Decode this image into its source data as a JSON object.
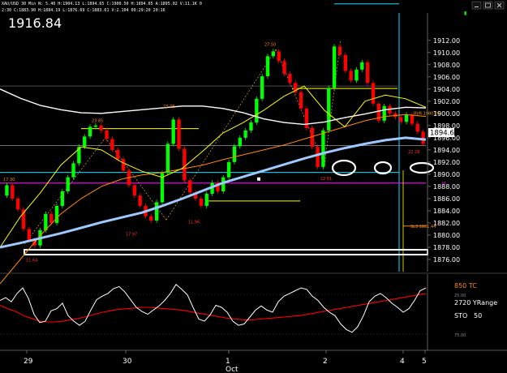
{
  "header": {
    "symbol_line": "XAU/USD 30 Min  N: 5.40  H:1904.13  L:1894.65  C:1900.50  H:1894.65  A:1895.02  V:11.1K  0",
    "stats_line": "2:30  C:1883.90  H:1884.19  L:1876.69  C:1883.61  V:2.104  09:29:20  20:16",
    "big_price": "1916.84"
  },
  "window_controls": [
    "minimize",
    "maximize",
    "close"
  ],
  "colors": {
    "up_candle": "#00ff00",
    "down_candle": "#ff0000",
    "ma_slow": "#ffffff",
    "ma_fast": "#ffff00",
    "ma_orange": "#ff8c00",
    "ma_blue": "#9ec9ff",
    "support_magenta": "#ff00ff",
    "cyan_level": "#00e5ff",
    "osc_red": "#ff0000",
    "osc_white": "#ffffff"
  },
  "chart_data": {
    "type": "candlestick",
    "price_axis": {
      "ticks": [
        "1912.00",
        "1910.00",
        "1908.00",
        "1906.00",
        "1904.00",
        "1902.00",
        "1900.00",
        "1898.00",
        "1896.00",
        "1894.00",
        "1892.00",
        "1890.00",
        "1888.00",
        "1886.00",
        "1884.00",
        "1882.00",
        "1880.00",
        "1878.00",
        "1876.00"
      ],
      "ylim": [
        1874,
        1916.5
      ]
    },
    "current_price": "1894.65",
    "date_axis": [
      "29",
      "30",
      "Oct",
      "1",
      "2",
      "4",
      "5"
    ],
    "candles": [
      [
        1886.5,
        1888.2
      ],
      [
        1888.2,
        1886.0
      ],
      [
        1886.0,
        1884.2
      ],
      [
        1884.2,
        1881.0
      ],
      [
        1881.0,
        1879.2
      ],
      [
        1879.2,
        1878.3
      ],
      [
        1878.3,
        1880.8
      ],
      [
        1880.8,
        1883.5
      ],
      [
        1883.5,
        1882.0
      ],
      [
        1882.0,
        1884.8
      ],
      [
        1884.8,
        1887.2
      ],
      [
        1887.2,
        1889.5
      ],
      [
        1889.5,
        1891.8
      ],
      [
        1891.8,
        1894.5
      ],
      [
        1894.5,
        1896.2
      ],
      [
        1896.2,
        1897.8
      ],
      [
        1897.8,
        1898.0
      ],
      [
        1898.0,
        1897.2
      ],
      [
        1897.2,
        1895.8
      ],
      [
        1895.8,
        1894.0
      ],
      [
        1894.0,
        1892.5
      ],
      [
        1892.5,
        1890.6
      ],
      [
        1890.6,
        1888.2
      ],
      [
        1888.2,
        1886.5
      ],
      [
        1886.5,
        1884.8
      ],
      [
        1884.8,
        1883.1
      ],
      [
        1883.1,
        1882.4
      ],
      [
        1882.4,
        1885.4
      ],
      [
        1885.4,
        1890.2
      ],
      [
        1890.2,
        1895.0
      ],
      [
        1895.0,
        1899.0
      ],
      [
        1899.0,
        1894.2
      ],
      [
        1894.2,
        1889.0
      ],
      [
        1889.0,
        1887.0
      ],
      [
        1887.0,
        1886.0
      ],
      [
        1886.0,
        1884.8
      ],
      [
        1884.8,
        1886.8
      ],
      [
        1886.8,
        1888.6
      ],
      [
        1888.6,
        1887.2
      ],
      [
        1887.2,
        1889.5
      ],
      [
        1889.5,
        1892.0
      ],
      [
        1892.0,
        1894.6
      ],
      [
        1894.6,
        1896.0
      ],
      [
        1896.0,
        1897.2
      ],
      [
        1897.2,
        1898.5
      ],
      [
        1898.5,
        1902.4
      ],
      [
        1902.4,
        1906.1
      ],
      [
        1906.1,
        1909.4
      ],
      [
        1909.4,
        1910.2
      ],
      [
        1910.2,
        1908.6
      ],
      [
        1908.6,
        1906.5
      ],
      [
        1906.5,
        1905.0
      ],
      [
        1905.0,
        1903.5
      ],
      [
        1903.5,
        1900.8
      ],
      [
        1900.8,
        1897.6
      ],
      [
        1897.6,
        1894.5
      ],
      [
        1894.5,
        1891.2
      ],
      [
        1891.2,
        1897.2
      ],
      [
        1897.2,
        1904.2
      ],
      [
        1904.2,
        1911.0
      ],
      [
        1911.0,
        1909.6
      ],
      [
        1909.6,
        1907.0
      ],
      [
        1907.0,
        1905.4
      ],
      [
        1905.4,
        1907.2
      ],
      [
        1907.2,
        1908.4
      ],
      [
        1908.4,
        1905.0
      ],
      [
        1905.0,
        1901.6
      ],
      [
        1901.6,
        1898.8
      ],
      [
        1898.8,
        1901.2
      ],
      [
        1901.2,
        1900.0
      ],
      [
        1900.0,
        1899.4
      ],
      [
        1899.4,
        1898.6
      ],
      [
        1898.6,
        1899.8
      ],
      [
        1899.8,
        1898.3
      ],
      [
        1898.3,
        1897.0
      ],
      [
        1897.0,
        1895.0
      ]
    ],
    "ma_white": [
      1904.0,
      1902.5,
      1901.3,
      1900.6,
      1900.1,
      1900.0,
      1900.3,
      1900.6,
      1900.9,
      1901.2,
      1901.2,
      1900.8,
      1900.1,
      1899.1,
      1898.5,
      1898.2,
      1898.6,
      1899.3,
      1899.9,
      1900.6,
      1901.0,
      1900.9
    ],
    "ma_orange": [
      1872.0,
      1876.0,
      1880.0,
      1883.5,
      1886.0,
      1888.0,
      1889.2,
      1889.9,
      1890.3,
      1890.9,
      1891.5,
      1892.4,
      1893.2,
      1894.0,
      1894.8,
      1895.8,
      1896.8,
      1897.8,
      1898.8,
      1899.5,
      1899.8,
      1899.5
    ],
    "ma_yellow": [
      1878.0,
      1883.0,
      1887.0,
      1891.5,
      1894.5,
      1894.0,
      1892.0,
      1890.5,
      1889.5,
      1891.0,
      1893.8,
      1896.8,
      1898.5,
      1900.5,
      1902.8,
      1904.5,
      1900.5,
      1897.8,
      1902.0,
      1903.0,
      1902.4,
      1901.0
    ],
    "ma_blue": [
      1878.0,
      1878.7,
      1879.5,
      1880.3,
      1881.2,
      1882.1,
      1882.9,
      1883.7,
      1884.8,
      1886.0,
      1887.3,
      1888.6,
      1889.6,
      1890.6,
      1891.6,
      1892.6,
      1893.5,
      1894.3,
      1895.0,
      1895.6,
      1896.0,
      1895.7
    ],
    "levels": {
      "support_white": 1877.2,
      "magenta": 1888.55,
      "cyan_bottom": 1890.3,
      "cyan_top": 1918.0,
      "grey_line": 1894.7,
      "yellow_left": 1897.5,
      "yellow_right": 1904.1,
      "yellow_low": 1885.6,
      "orange_short": 1881.5
    },
    "annotations": {
      "peak_1": "23.85",
      "peak_2": "23.78",
      "peak_3": "27.50",
      "trough_1": "17.97",
      "trough_2": "11.96",
      "trough_3": "22.61",
      "left_high": "17.30",
      "left_low": "11.64",
      "dn_label": "22.28",
      "rvr_label": "RVR 1900.05",
      "sl_label": "SL3 1881.44",
      "magenta_tag": "M"
    },
    "oscillator": {
      "labels": [
        "850 TC",
        "2720 YRange",
        "STO",
        "50"
      ],
      "axis_ticks": [
        "25.00",
        "75.00"
      ],
      "white_line": [
        72,
        76,
        70,
        82,
        90,
        75,
        52,
        40,
        42,
        57,
        60,
        68,
        50,
        42,
        36,
        42,
        58,
        73,
        78,
        82,
        89,
        92,
        84,
        73,
        62,
        56,
        52,
        58,
        64,
        72,
        82,
        95,
        88,
        80,
        62,
        45,
        42,
        51,
        65,
        62,
        55,
        42,
        36,
        38,
        48,
        58,
        64,
        58,
        55,
        70,
        78,
        82,
        86,
        90,
        88,
        78,
        72,
        62,
        55,
        50,
        38,
        30,
        26,
        34,
        50,
        70,
        78,
        82,
        76,
        68,
        62,
        55,
        60,
        72,
        86,
        90
      ],
      "red_line": [
        65,
        60,
        56,
        50,
        46,
        42,
        41,
        41,
        42,
        44,
        46,
        49,
        52,
        55,
        57,
        59,
        60,
        61,
        62,
        62,
        61,
        60,
        59,
        58,
        56,
        54,
        52,
        50,
        48,
        46,
        45,
        44,
        44,
        45,
        46,
        47,
        48,
        49,
        50,
        52,
        54,
        56,
        58,
        60,
        62,
        64,
        66,
        68,
        70,
        72,
        74,
        76,
        78,
        80,
        82
      ]
    }
  }
}
